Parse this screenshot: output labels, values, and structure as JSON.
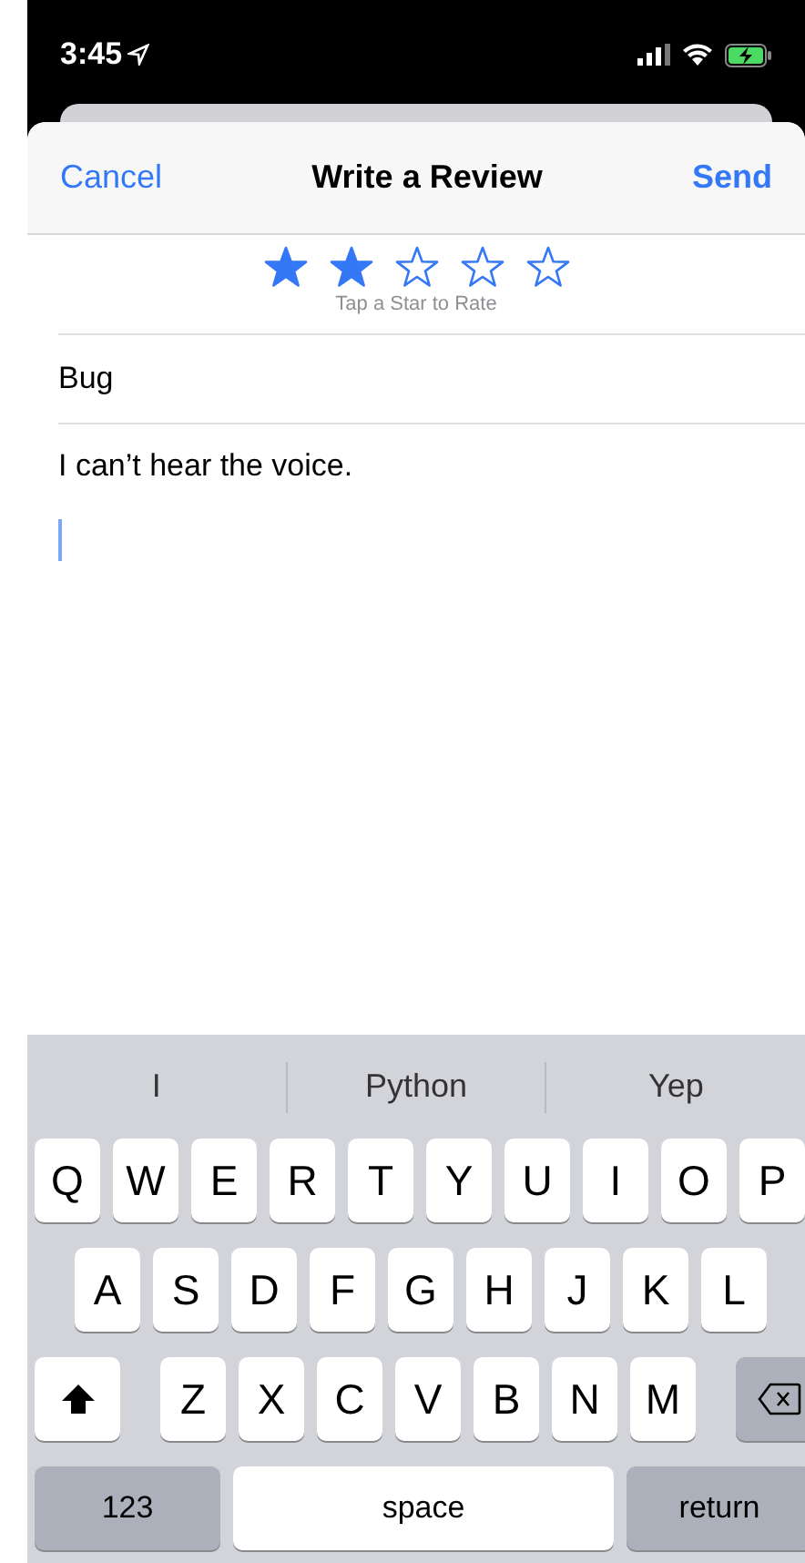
{
  "status_bar": {
    "time": "3:45"
  },
  "nav": {
    "cancel": "Cancel",
    "title": "Write a Review",
    "send": "Send"
  },
  "rating": {
    "stars": 2,
    "caption": "Tap a Star to Rate"
  },
  "review_title": {
    "value": "Bug"
  },
  "review_body": {
    "value": "I can’t hear the voice."
  },
  "keyboard": {
    "suggestions": [
      "I",
      "Python",
      "Yep"
    ],
    "rows": [
      [
        "Q",
        "W",
        "E",
        "R",
        "T",
        "Y",
        "U",
        "I",
        "O",
        "P"
      ],
      [
        "A",
        "S",
        "D",
        "F",
        "G",
        "H",
        "J",
        "K",
        "L"
      ],
      [
        "Z",
        "X",
        "C",
        "V",
        "B",
        "N",
        "M"
      ]
    ],
    "numbers_key": "123",
    "space_key": "space",
    "return_key": "return"
  }
}
